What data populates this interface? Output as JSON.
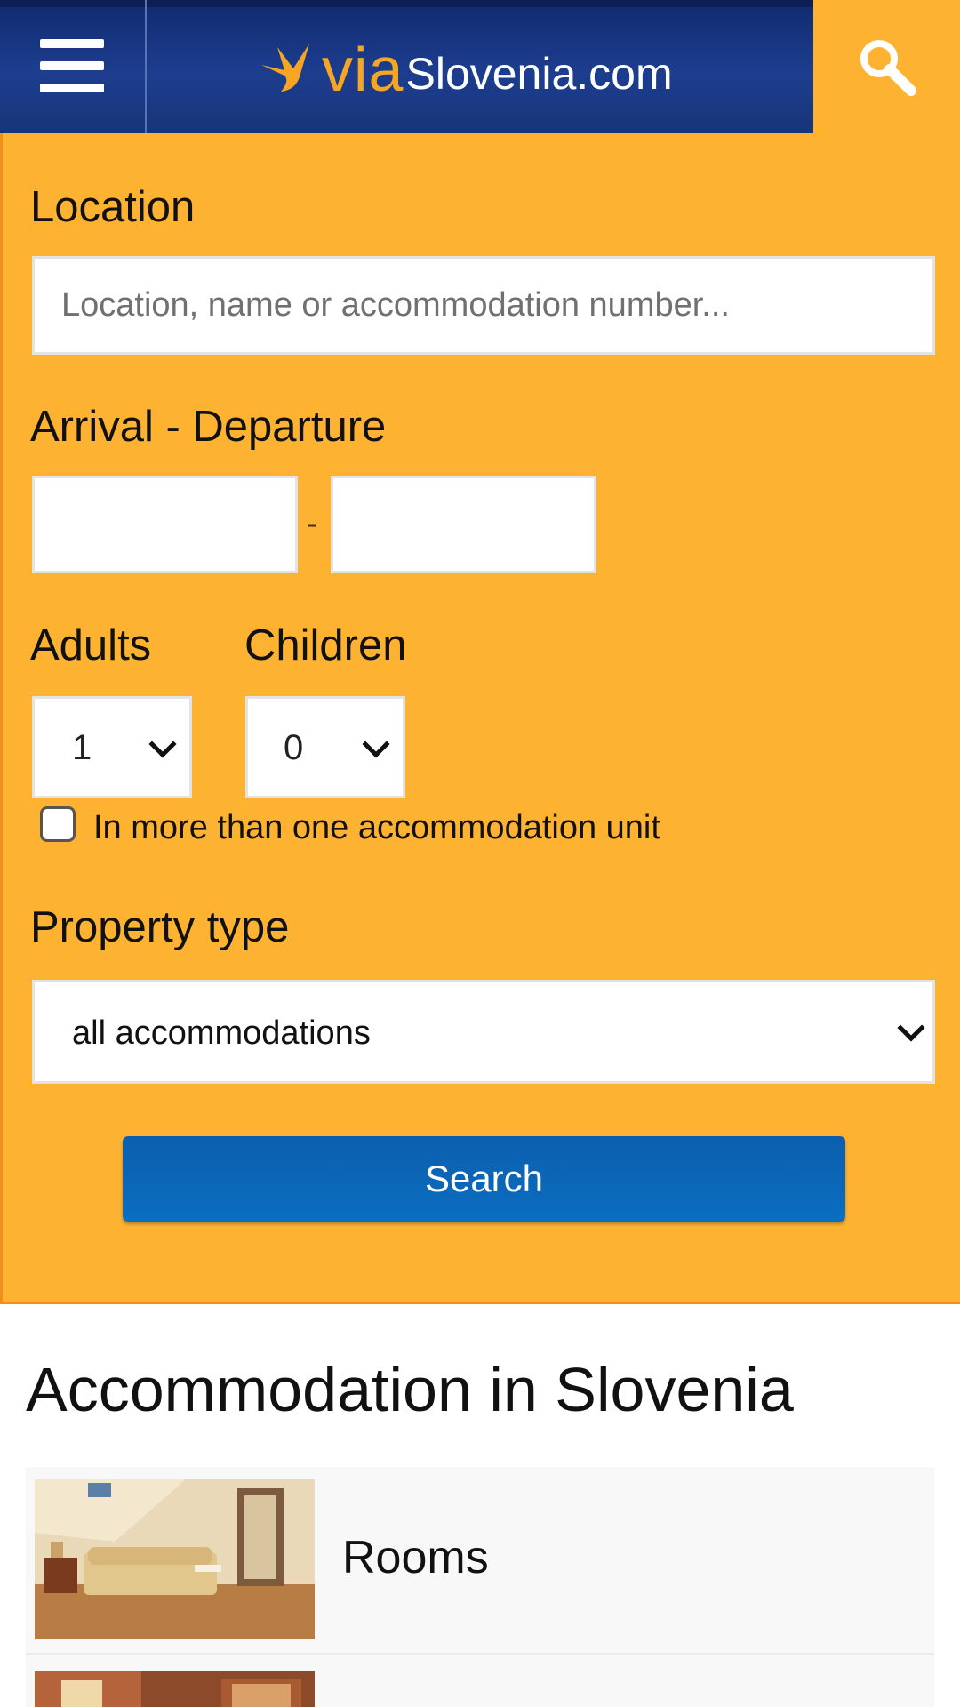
{
  "header": {
    "logo_via": "via",
    "logo_rest": "Slovenia.com",
    "menu_icon": "hamburger-menu-icon",
    "search_icon": "magnifier-icon",
    "bar_color": "#1d3d8f",
    "accent_color": "#fdb232"
  },
  "search_form": {
    "location_label": "Location",
    "location_placeholder": "Location, name or accommodation number...",
    "location_value": "",
    "dates_label": "Arrival - Departure",
    "arrival_value": "",
    "departure_value": "",
    "date_separator": "-",
    "adults_label": "Adults",
    "adults_value": "1",
    "children_label": "Children",
    "children_value": "0",
    "multi_unit_checked": false,
    "multi_unit_label": "In more than one accommodation unit",
    "property_type_label": "Property type",
    "property_type_value": "all accommodations",
    "search_button_label": "Search",
    "button_color": "#0b67b8"
  },
  "results": {
    "title": "Accommodation in Slovenia",
    "items": [
      {
        "label": "Rooms",
        "thumbnail": "bedroom-photo"
      },
      {
        "label": "",
        "thumbnail": "bedroom-photo"
      }
    ]
  }
}
